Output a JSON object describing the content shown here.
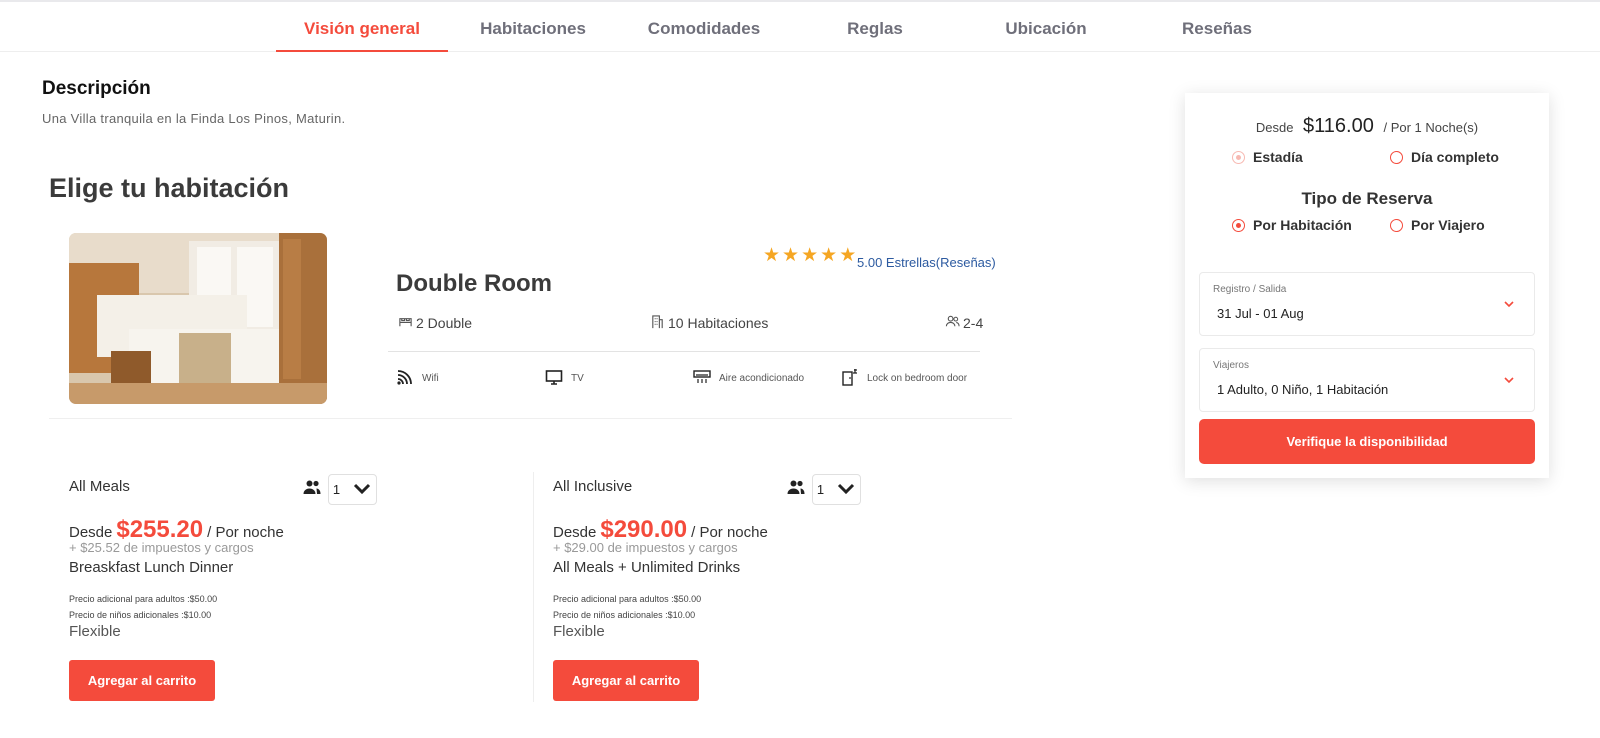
{
  "tabs": [
    {
      "label": "Visión general",
      "active": true
    },
    {
      "label": "Habitaciones",
      "active": false
    },
    {
      "label": "Comodidades",
      "active": false
    },
    {
      "label": "Reglas",
      "active": false
    },
    {
      "label": "Ubicación",
      "active": false
    },
    {
      "label": "Reseñas",
      "active": false
    }
  ],
  "description": {
    "title": "Descripción",
    "text": "Una Villa tranquila en la Finda Los Pinos, Maturin."
  },
  "choose_title": "Elige tu habitación",
  "room": {
    "name": "Double Room",
    "rating_stars": 5,
    "rating_text": "5.00 Estrellas(Reseñas)",
    "beds": "2 Double",
    "rooms": "10 Habitaciones",
    "guests": "2-4",
    "amenities": [
      {
        "label": "Wifi",
        "icon": "wifi-icon"
      },
      {
        "label": "TV",
        "icon": "tv-icon"
      },
      {
        "label": "Aire acondicionado",
        "icon": "air-conditioner-icon"
      },
      {
        "label": "Lock on bedroom door",
        "icon": "door-lock-icon"
      }
    ]
  },
  "plans": [
    {
      "name": "All Meals",
      "qty": "1",
      "from": "Desde",
      "price": "$255.20",
      "per": "/ Por noche",
      "taxes": "+ $25.52 de impuestos y cargos",
      "meals": "Breaskfast Lunch Dinner",
      "adult_extra": "Precio adicional para adultos :$50.00",
      "kids_extra": "Precio de niños adicionales :$10.00",
      "policy": "Flexible",
      "button": "Agregar al carrito"
    },
    {
      "name": "All Inclusive",
      "qty": "1",
      "from": "Desde",
      "price": "$290.00",
      "per": "/ Por noche",
      "taxes": "+ $29.00 de impuestos y cargos",
      "meals": "All Meals + Unlimited Drinks",
      "adult_extra": "Precio adicional para adultos :$50.00",
      "kids_extra": "Precio de niños adicionales :$10.00",
      "policy": "Flexible",
      "button": "Agregar al carrito"
    }
  ],
  "booking": {
    "from": "Desde",
    "price": "$116.00",
    "per": "/ Por 1 Noche(s)",
    "stay_options": [
      {
        "label": "Estadía",
        "selected": true
      },
      {
        "label": "Día completo",
        "selected": false
      }
    ],
    "type_title": "Tipo de Reserva",
    "type_options": [
      {
        "label": "Por Habitación",
        "selected": true
      },
      {
        "label": "Por Viajero",
        "selected": false
      }
    ],
    "dates_label": "Registro / Salida",
    "dates_value": "31 Jul - 01 Aug",
    "travelers_label": "Viajeros",
    "travelers_value": "1 Adulto, 0 Niño, 1 Habitación",
    "check_button": "Verifique la disponibilidad"
  },
  "colors": {
    "accent": "#f44b3c",
    "star": "#f5a623",
    "link": "#2c5aa0"
  }
}
